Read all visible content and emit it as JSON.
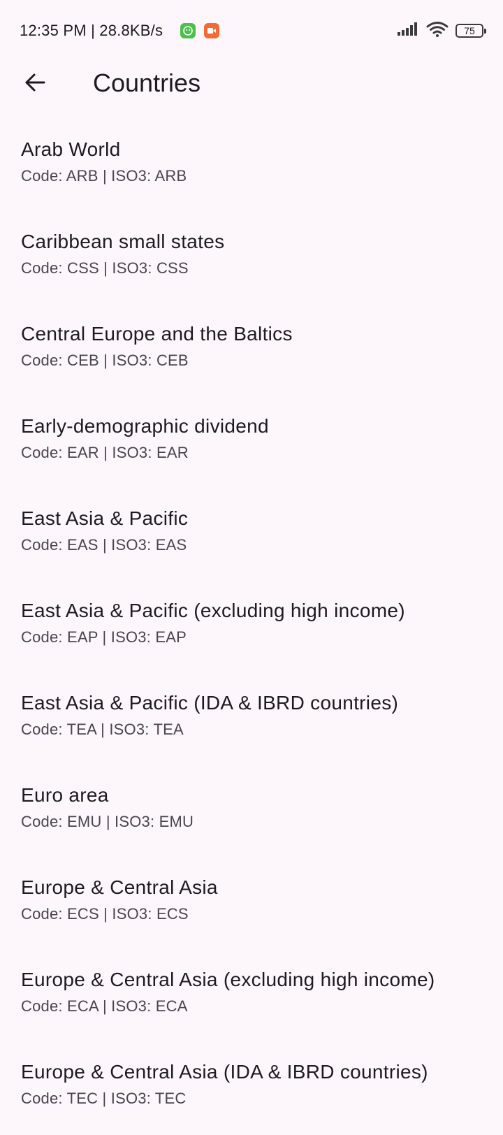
{
  "status_bar": {
    "time": "12:35 PM | 28.8KB/s",
    "battery": "75"
  },
  "app_bar": {
    "title": "Countries"
  },
  "countries": [
    {
      "name": "Arab World",
      "subtitle": "Code: ARB | ISO3: ARB"
    },
    {
      "name": "Caribbean small states",
      "subtitle": "Code: CSS | ISO3: CSS"
    },
    {
      "name": "Central Europe and the Baltics",
      "subtitle": "Code: CEB | ISO3: CEB"
    },
    {
      "name": "Early-demographic dividend",
      "subtitle": "Code: EAR | ISO3: EAR"
    },
    {
      "name": "East Asia & Pacific",
      "subtitle": "Code: EAS | ISO3: EAS"
    },
    {
      "name": "East Asia & Pacific (excluding high income)",
      "subtitle": "Code: EAP | ISO3: EAP"
    },
    {
      "name": "East Asia & Pacific (IDA & IBRD countries)",
      "subtitle": "Code: TEA | ISO3: TEA"
    },
    {
      "name": "Euro area",
      "subtitle": "Code: EMU | ISO3: EMU"
    },
    {
      "name": "Europe & Central Asia",
      "subtitle": "Code: ECS | ISO3: ECS"
    },
    {
      "name": "Europe & Central Asia (excluding high income)",
      "subtitle": "Code: ECA | ISO3: ECA"
    },
    {
      "name": "Europe & Central Asia (IDA & IBRD countries)",
      "subtitle": "Code: TEC | ISO3: TEC"
    }
  ]
}
